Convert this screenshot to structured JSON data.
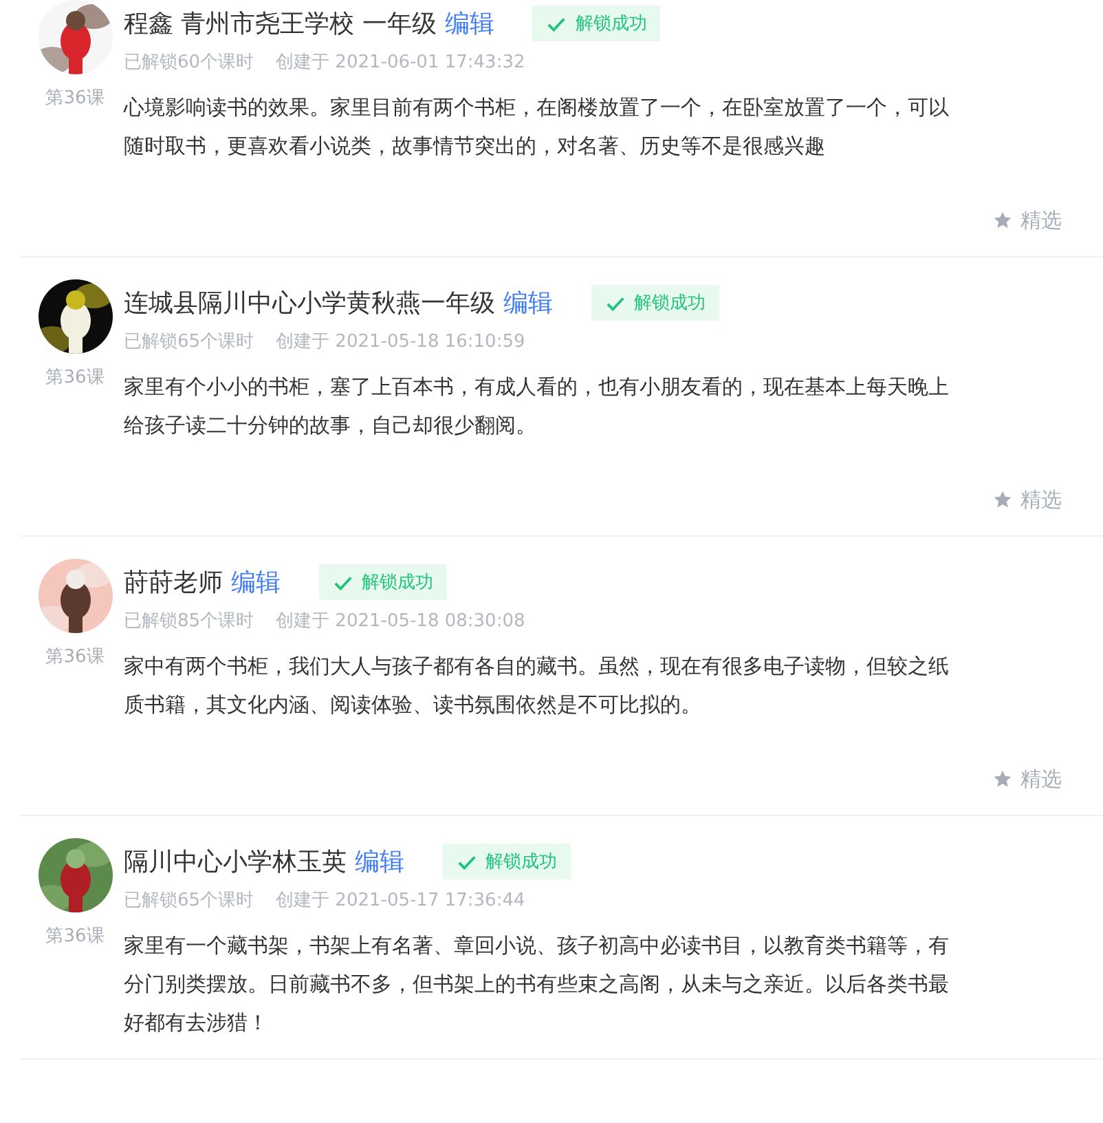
{
  "posts": [
    {
      "author": "程鑫 青州市尧王学校 一年级",
      "edit": "编辑",
      "badge": "解锁成功",
      "unlocked": "已解锁60个课时",
      "created": "创建于 2021-06-01 17:43:32",
      "lesson": "第36课",
      "text": "心境影响读书的效果。家里目前有两个书柜，在阁楼放置了一个，在卧室放置了一个，可以随时取书，更喜欢看小说类，故事情节突出的，对名著、历史等不是很感兴趣",
      "featured_label": "精选",
      "featured": false
    },
    {
      "author": "连城县隔川中心小学黄秋燕一年级",
      "edit": "编辑",
      "badge": "解锁成功",
      "unlocked": "已解锁65个课时",
      "created": "创建于 2021-05-18 16:10:59",
      "lesson": "第36课",
      "text": "家里有个小小的书柜，塞了上百本书，有成人看的，也有小朋友看的，现在基本上每天晚上给孩子读二十分钟的故事，自己却很少翻阅。",
      "featured_label": "精选",
      "featured": false
    },
    {
      "author": "莳莳老师",
      "edit": "编辑",
      "badge": "解锁成功",
      "unlocked": "已解锁85个课时",
      "created": "创建于 2021-05-18 08:30:08",
      "lesson": "第36课",
      "text": "家中有两个书柜，我们大人与孩子都有各自的藏书。虽然，现在有很多电子读物，但较之纸质书籍，其文化内涵、阅读体验、读书氛围依然是不可比拟的。",
      "featured_label": "精选",
      "featured": false
    },
    {
      "author": "隔川中心小学林玉英",
      "edit": "编辑",
      "badge": "解锁成功",
      "unlocked": "已解锁65个课时",
      "created": "创建于 2021-05-17 17:36:44",
      "lesson": "第36课",
      "text": "家里有一个藏书架，书架上有名著、章回小说、孩子初高中必读书目，以教育类书籍等，有分门别类摆放。日前藏书不多，但书架上的书有些束之高阁，从未与之亲近。以后各类书最好都有去涉猎！"
    }
  ]
}
